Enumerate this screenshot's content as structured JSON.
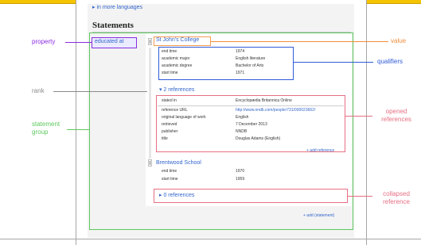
{
  "page": {
    "more_languages": "▸ in more languages",
    "heading": "Statements"
  },
  "statement": {
    "property": "educated at",
    "value1": "St John's College",
    "qualifiers1": [
      {
        "key": "end time",
        "value": "1974"
      },
      {
        "key": "academic major",
        "value": "English literature"
      },
      {
        "key": "academic degree",
        "value": "Bachelor of Arts"
      },
      {
        "key": "start time",
        "value": "1971"
      }
    ],
    "references_link1": "▾ 2 references",
    "references": [
      {
        "key": "stated in",
        "value": "Encyclopædia Britannica Online",
        "link": false
      },
      {
        "key": "reference URL",
        "value": "http://www.nndb.com/people/731/000023662/",
        "link": true
      },
      {
        "key": "original language of work",
        "value": "English",
        "link": false
      },
      {
        "key": "retrieved",
        "value": "7 December 2013",
        "link": false
      },
      {
        "key": "publisher",
        "value": "NNDB",
        "link": false
      },
      {
        "key": "title",
        "value": "Douglas Adams (English)",
        "link": false
      }
    ],
    "add_reference": "+ add reference",
    "value2": "Brentwood School",
    "qualifiers2": [
      {
        "key": "end time",
        "value": "1970"
      },
      {
        "key": "start time",
        "value": "1959"
      }
    ],
    "references_link2": "▸ 0 references",
    "add_statement": "+ add (statement)"
  },
  "annotations": {
    "property": "property",
    "value": "value",
    "qualifiers": "qualifiers",
    "rank": "rank",
    "statement_group_line1": "statement",
    "statement_group_line2": "group",
    "opened_references_line1": "opened",
    "opened_references_line2": "references",
    "collapsed_reference_line1": "collapsed",
    "collapsed_reference_line2": "reference"
  },
  "colors": {
    "property": "#8a2be2",
    "value": "#f08c3a",
    "qualifiers": "#2f5bd8",
    "rank": "#8a8a8a",
    "statement_group": "#5fc85f",
    "references": "#e66f82",
    "link": "#3366cc"
  }
}
